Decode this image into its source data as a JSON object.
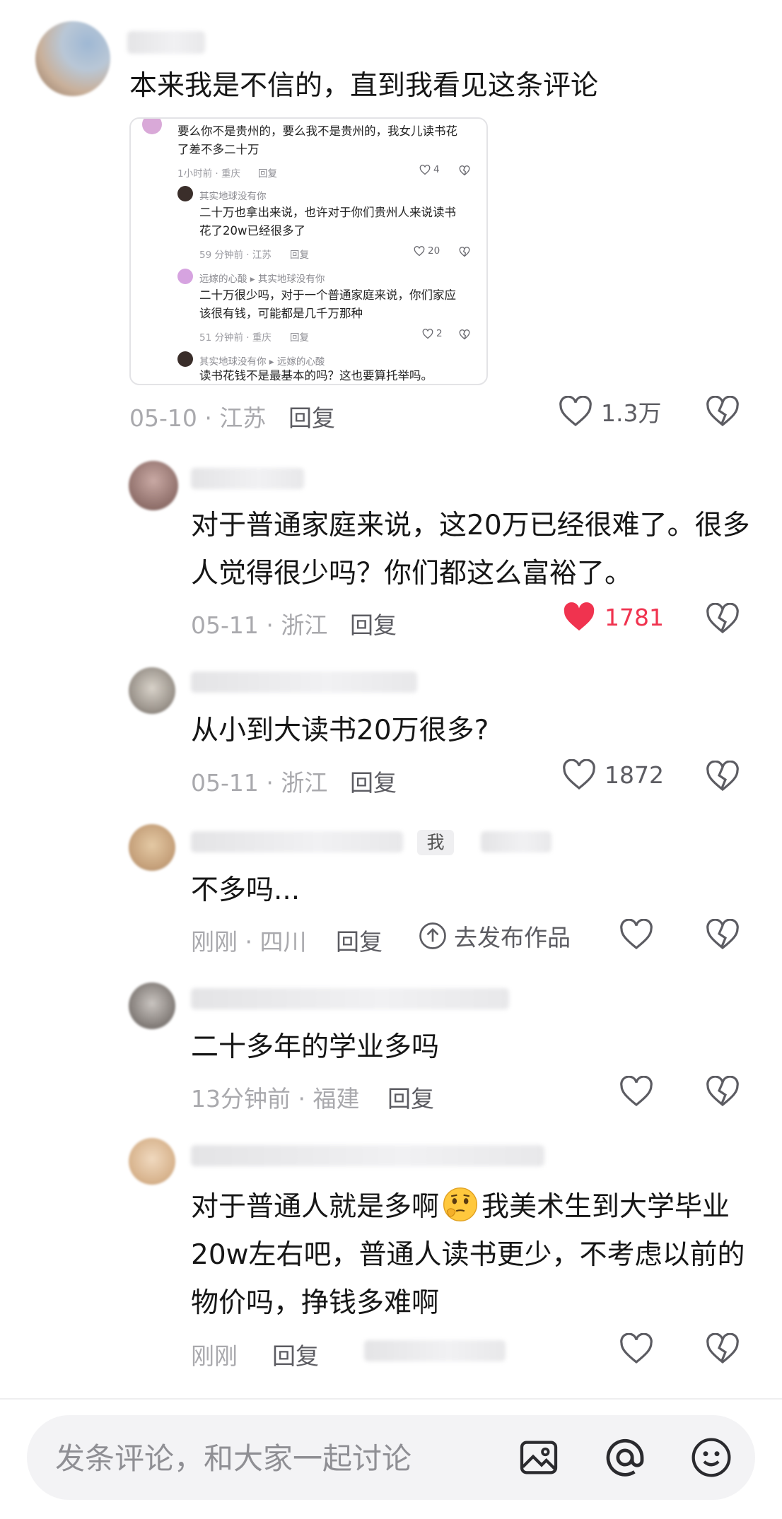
{
  "comments": [
    {
      "text": "本来我是不信的，直到我看见这条评论",
      "date_location": "05-10 · 江苏",
      "reply_label": "回复",
      "likes": "1.3万",
      "liked": false,
      "embedded": {
        "c1_text_l1": "要么你不是贵州的，要么我不是贵州的，我女儿读书花",
        "c1_text_l2": "了差不多二十万",
        "c1_meta": "1小时前 · 重庆",
        "c1_reply": "回复",
        "c1_likes": "4",
        "c2_name": "其实地球没有你",
        "c2_text_l1": "二十万也拿出来说，也许对于你们贵州人来说读书",
        "c2_text_l2": "花了20w已经很多了",
        "c2_meta": "59 分钟前 · 江苏",
        "c2_reply": "回复",
        "c2_likes": "20",
        "c3_name": "远嫁的心酸",
        "c3_target": "其实地球没有你",
        "c3_text_l1": "二十万很少吗，对于一个普通家庭来说，你们家应",
        "c3_text_l2": "该很有钱，可能都是几千万那种",
        "c3_meta": "51 分钟前 · 重庆",
        "c3_reply": "回复",
        "c3_likes": "2",
        "c4_name": "其实地球没有你",
        "c4_target": "远嫁的心酸",
        "c4_text": "读书花钱不是最基本的吗？这也要算托举吗。"
      }
    },
    {
      "text_l1": "对于普通家庭来说，这20万已经很难了。很多",
      "text_l2": "人觉得很少吗？你们都这么富裕了。",
      "date_location": "05-11 · 浙江",
      "reply_label": "回复",
      "likes": "1781",
      "liked": true
    },
    {
      "text": "从小到大读书20万很多?",
      "date_location": "05-11 · 浙江",
      "reply_label": "回复",
      "likes": "1872",
      "liked": false
    },
    {
      "badge": "我",
      "text": "不多吗...",
      "date_location": "刚刚 · 四川",
      "reply_label": "回复",
      "publish_label": "去发布作品",
      "liked": false
    },
    {
      "text": "二十多年的学业多吗",
      "date_location": "13分钟前 · 福建",
      "reply_label": "回复",
      "liked": false
    },
    {
      "text_l1_a": "对于普通人就是多啊",
      "text_l1_b": "我美术生到大学毕业",
      "text_l2": "20w左右吧，普通人读书更少，不考虑以前的",
      "text_l3": "物价吗，挣钱多难啊",
      "emoji": "thinking-face-emoji",
      "date_location": "刚刚",
      "reply_label": "回复",
      "liked": false
    }
  ],
  "input": {
    "placeholder": "发条评论，和大家一起讨论",
    "icons": [
      "image-icon",
      "at-icon",
      "emoji-icon"
    ]
  },
  "colors": {
    "liked": "#f0334f",
    "meta": "#a9a9ad",
    "text": "#161616"
  }
}
